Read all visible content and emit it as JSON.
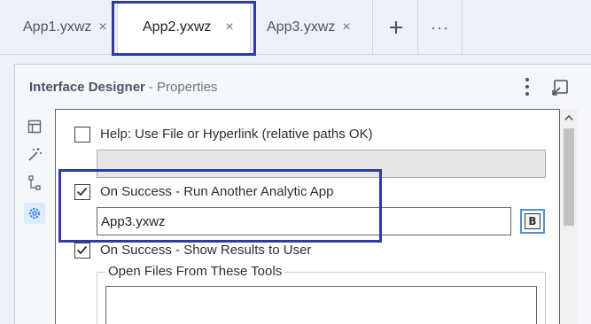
{
  "tabs": [
    {
      "label": "App1.yxwz",
      "close": "×"
    },
    {
      "label": "App2.yxwz",
      "close": "×"
    },
    {
      "label": "App3.yxwz",
      "close": "×"
    }
  ],
  "tab_actions": {
    "add_icon": "plus-icon",
    "more_label": "···"
  },
  "panel": {
    "title": "Interface Designer",
    "subtitle": "- Properties"
  },
  "toolbar_icons": [
    "layout-icon",
    "magic-wand-icon",
    "tree-icon",
    "gear-icon"
  ],
  "properties": {
    "help": {
      "label": "Help: Use File or Hyperlink (relative paths OK)",
      "checked": false,
      "value": ""
    },
    "run_app": {
      "label": "On Success - Run Another Analytic App",
      "checked": true,
      "value": "App3.yxwz"
    },
    "show_results": {
      "label": "On Success - Show Results to User",
      "checked": true
    },
    "open_files_label": "Open Files From These Tools"
  },
  "colors": {
    "highlight": "#2e3aa6",
    "accent": "#4a90d9",
    "active_tool_bg": "#dbeafe"
  }
}
